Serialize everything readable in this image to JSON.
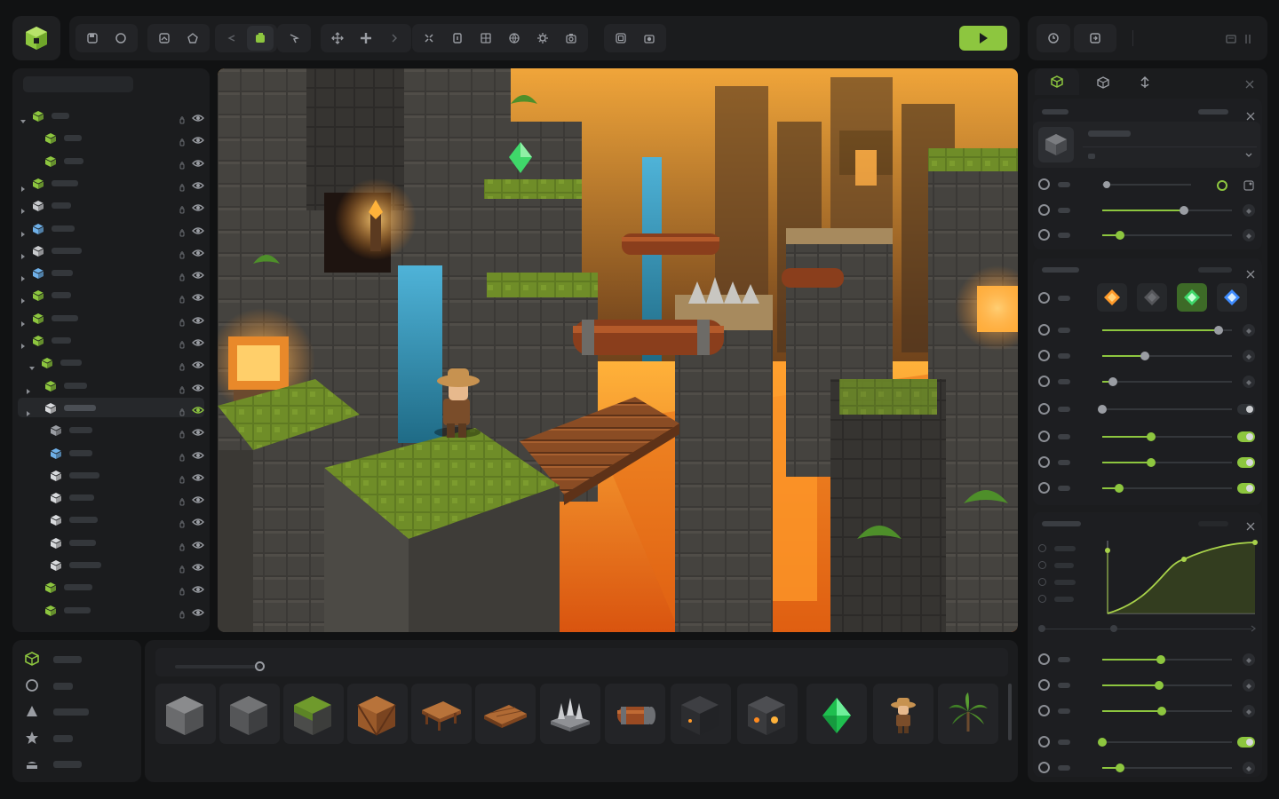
{
  "app": {
    "accent": "#8dc63f",
    "logo_icon": "cube-logo-icon"
  },
  "toolbar": {
    "groups": [
      [
        "save-icon",
        "circle-icon"
      ],
      [
        "save-as-icon",
        "shape-icon"
      ],
      [
        "undo-icon",
        "redo-icon"
      ],
      [
        "pointer-icon"
      ],
      [
        "move-icon",
        "move-all-icon",
        "chevron-right-icon"
      ],
      [
        "scale-icon",
        "frame-icon",
        "grid-icon",
        "globe-icon",
        "gear-icon",
        "camera-icon"
      ],
      [
        "screenshot-icon",
        "capture-icon"
      ]
    ],
    "play_icon": "play-icon"
  },
  "top_right": {
    "buttons": [
      "history-icon",
      "export-icon",
      "minimize-icon",
      "panel-icon"
    ]
  },
  "outliner": {
    "rows": [
      {
        "depth": 0,
        "expand": "open",
        "color": "#8dc63f",
        "name_w": 20
      },
      {
        "depth": 1,
        "expand": "",
        "color": "#8dc63f",
        "name_w": 20
      },
      {
        "depth": 1,
        "expand": "",
        "color": "#8dc63f",
        "name_w": 22
      },
      {
        "depth": 0,
        "expand": "closed",
        "color": "#8dc63f",
        "name_w": 30
      },
      {
        "depth": 0,
        "expand": "closed",
        "color": "#c8cacd",
        "name_w": 22
      },
      {
        "depth": 0,
        "expand": "closed",
        "color": "#6fb0e8",
        "name_w": 26
      },
      {
        "depth": 0,
        "expand": "closed",
        "color": "#c8cacd",
        "name_w": 34
      },
      {
        "depth": 0,
        "expand": "closed",
        "color": "#6fb0e8",
        "name_w": 24
      },
      {
        "depth": 0,
        "expand": "closed",
        "color": "#8dc63f",
        "name_w": 22
      },
      {
        "depth": 0,
        "expand": "closed",
        "color": "#8dc63f",
        "name_w": 30
      },
      {
        "depth": 0,
        "expand": "closed",
        "color": "#8dc63f",
        "name_w": 22
      },
      {
        "depth": 0,
        "expand": "open",
        "color": "#8dc63f",
        "name_w": 24,
        "indent": 10
      },
      {
        "depth": 1,
        "expand": "closed",
        "color": "#8dc63f",
        "name_w": 26
      },
      {
        "depth": 1,
        "expand": "closed",
        "color": "#d7d9dc",
        "name_w": 36,
        "selected": true
      },
      {
        "depth": 2,
        "expand": "",
        "color": "#9a9da3",
        "name_w": 26
      },
      {
        "depth": 2,
        "expand": "",
        "color": "#6fb0e8",
        "name_w": 26
      },
      {
        "depth": 2,
        "expand": "",
        "color": "#d7d9dc",
        "name_w": 34
      },
      {
        "depth": 2,
        "expand": "",
        "color": "#d7d9dc",
        "name_w": 28
      },
      {
        "depth": 2,
        "expand": "",
        "color": "#d7d9dc",
        "name_w": 32
      },
      {
        "depth": 2,
        "expand": "",
        "color": "#d7d9dc",
        "name_w": 30
      },
      {
        "depth": 2,
        "expand": "",
        "color": "#d7d9dc",
        "name_w": 36
      },
      {
        "depth": 1,
        "expand": "",
        "color": "#8dc63f",
        "name_w": 32
      },
      {
        "depth": 1,
        "expand": "",
        "color": "#8dc63f",
        "name_w": 30
      }
    ]
  },
  "palette": {
    "items": [
      {
        "icon": "cube-icon",
        "color": "#8dc63f",
        "w": 32
      },
      {
        "icon": "sphere-icon",
        "color": "#9a9da3",
        "w": 22
      },
      {
        "icon": "cone-icon",
        "color": "#9a9da3",
        "w": 40
      },
      {
        "icon": "star-icon",
        "color": "#9a9da3",
        "w": 22
      },
      {
        "icon": "mesh-icon",
        "color": "#9a9da3",
        "w": 32
      }
    ]
  },
  "assets": {
    "tiles": [
      "stone-block-tile",
      "dark-stone-block-tile",
      "mossy-block-tile",
      "wooden-crate-tile",
      "wooden-table-tile",
      "wooden-plank-tile",
      "spike-trap-tile",
      "log-tile",
      "dark-cube-tile",
      "lantern-cube-tile",
      "emerald-gem-tile",
      "explorer-character-tile",
      "palm-plant-tile"
    ]
  },
  "inspector": {
    "tabs": [
      "object-tab-icon",
      "mesh-tab-icon",
      "physics-tab-icon"
    ],
    "transform_rows": [
      {
        "type": "dropdown"
      },
      {
        "type": "slider",
        "value": 0.63
      },
      {
        "type": "slider",
        "value": 0.14
      }
    ],
    "materials": [
      "fire-material-icon",
      "stone-material-icon",
      "emerald-material-icon",
      "crystal-material-icon"
    ],
    "material_rows": [
      {
        "slider": 0.9,
        "toggle": null
      },
      {
        "slider": 0.33,
        "toggle": null,
        "end": true
      },
      {
        "slider": 0.08,
        "toggle": null
      },
      {
        "slider": 0.0,
        "toggle": "off"
      },
      {
        "slider": 0.38,
        "toggle": "on"
      },
      {
        "slider": 0.38,
        "toggle": "on",
        "green": true
      },
      {
        "slider": 0.13,
        "toggle": "on",
        "green": true
      }
    ],
    "curve": {
      "kind": "ease-curve"
    },
    "bottom_rows": [
      {
        "slider": 0.45
      },
      {
        "slider": 0.44
      },
      {
        "slider": 0.46
      },
      {
        "slider": 0.0,
        "toggle": "on"
      },
      {
        "slider": 0.14
      }
    ]
  }
}
